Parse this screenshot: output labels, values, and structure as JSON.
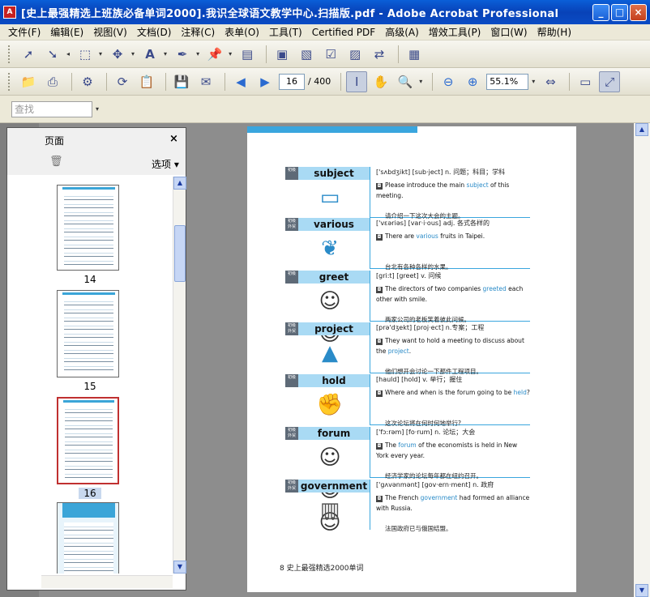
{
  "window": {
    "title": "[史上最强精选上班族必备单词2000].我识全球语文教学中心.扫描版.pdf - Adobe Acrobat Professional",
    "app_icon": "pdf-icon",
    "minimize": "_",
    "maximize": "□",
    "close": "×"
  },
  "menu": [
    "文件(F)",
    "编辑(E)",
    "视图(V)",
    "文档(D)",
    "注释(C)",
    "表单(O)",
    "工具(T)",
    "Certified PDF",
    "高级(A)",
    "增效工具(P)",
    "窗口(W)",
    "帮助(H)"
  ],
  "toolbar": {
    "page_current": "16",
    "page_total": "/ 400",
    "zoom": "55.1%",
    "find_placeholder": "查找"
  },
  "panel": {
    "title": "页面",
    "close": "×",
    "options": "选项",
    "options_arrow": "▾",
    "thumbnails": [
      {
        "label": "14",
        "selected": false
      },
      {
        "label": "15",
        "selected": false
      },
      {
        "label": "16",
        "selected": true
      },
      {
        "label": "",
        "selected": false
      }
    ]
  },
  "document": {
    "entries": [
      {
        "word": "subject",
        "tag": "初级",
        "phonetic": "['sʌbdʒikt] [sub·ject] n. 问题；科目；学科",
        "ex_before": "Please introduce the main ",
        "ex_hl": "subject",
        "ex_after": " of this meeting.",
        "zh": "请介绍一下这次大会的主题。",
        "icon": "board-icon"
      },
      {
        "word": "various",
        "tag": "初级 外贸",
        "phonetic": "['vɛəriəs] [var·i·ous] adj. 各式各样的",
        "ex_before": "There are ",
        "ex_hl": "various",
        "ex_after": " fruits in Taipei.",
        "zh": "台北有各种各样的水果。",
        "icon": "fruit-icon"
      },
      {
        "word": "greet",
        "tag": "初级",
        "phonetic": "[gri:t] [greet] v. 问候",
        "ex_before": "The directors of two companies ",
        "ex_hl": "greeted",
        "ex_after": " each other with smile.",
        "zh": "两家公司的老板笑着彼此问候。",
        "icon": "people-icon"
      },
      {
        "word": "project",
        "tag": "初级 外贸",
        "phonetic": "[prə'dʒekt] [proj·ect] n.专案；工程",
        "ex_before": "They want to hold a meeting to discuss about the ",
        "ex_hl": "project",
        "ex_after": ".",
        "zh": "他们想开会讨论一下那件工程项目。",
        "icon": "pyramid-icon"
      },
      {
        "word": "hold",
        "tag": "初级",
        "phonetic": "[hauld] [hold] v. 举行；握住",
        "ex_before": "Where and when is the forum going to be ",
        "ex_hl": "held",
        "ex_after": "?",
        "zh": "这次论坛将在何时何地举行?",
        "icon": "hand-icon"
      },
      {
        "word": "forum",
        "tag": "初级 外贸",
        "phonetic": "['fɔ:rəm] [fo·rum] n. 论坛；大会",
        "ex_before": "The ",
        "ex_hl": "forum",
        "ex_after": " of the economists is held in New York every year.",
        "zh": "经济学家的论坛每年都在纽约召开。",
        "icon": "crowd-icon"
      },
      {
        "word": "government",
        "tag": "初级 外贸",
        "phonetic": "['gʌvənmənt] [gov·ern·ment] n. 政府",
        "ex_before": "The French ",
        "ex_hl": "government",
        "ex_after": " had formed an alliance with Russia.",
        "zh": "法国政府已与俄国结盟。",
        "icon": "building-icon"
      }
    ],
    "footer": "8  史上最强精选2000单词"
  }
}
